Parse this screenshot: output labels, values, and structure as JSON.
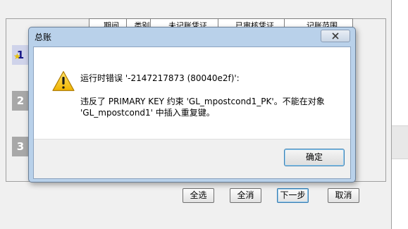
{
  "background": {
    "grid_columns": [
      "期间",
      "类别",
      "未记账凭证",
      "已审核凭证",
      "记账范围"
    ],
    "steps": [
      "1",
      "2",
      "3"
    ],
    "buttons": {
      "select_all": "全选",
      "clear_all": "全消",
      "next": "下一步",
      "cancel": "取消"
    }
  },
  "dialog": {
    "title": "总账",
    "close_icon": "close-x-icon",
    "icon": "warning-triangle-icon",
    "message_line1": "运行时错误 '-2147217873 (80040e2f)':",
    "message_line2": "违反了 PRIMARY KEY 约束 'GL_mpostcond1_PK'。不能在对象",
    "message_line3": "'GL_mpostcond1' 中插入重复键。",
    "ok_label": "确定"
  },
  "colors": {
    "dialog_frame": "#b9d1ea",
    "warning_yellow": "#f5c518",
    "focus_blue": "#3c7fb1"
  }
}
